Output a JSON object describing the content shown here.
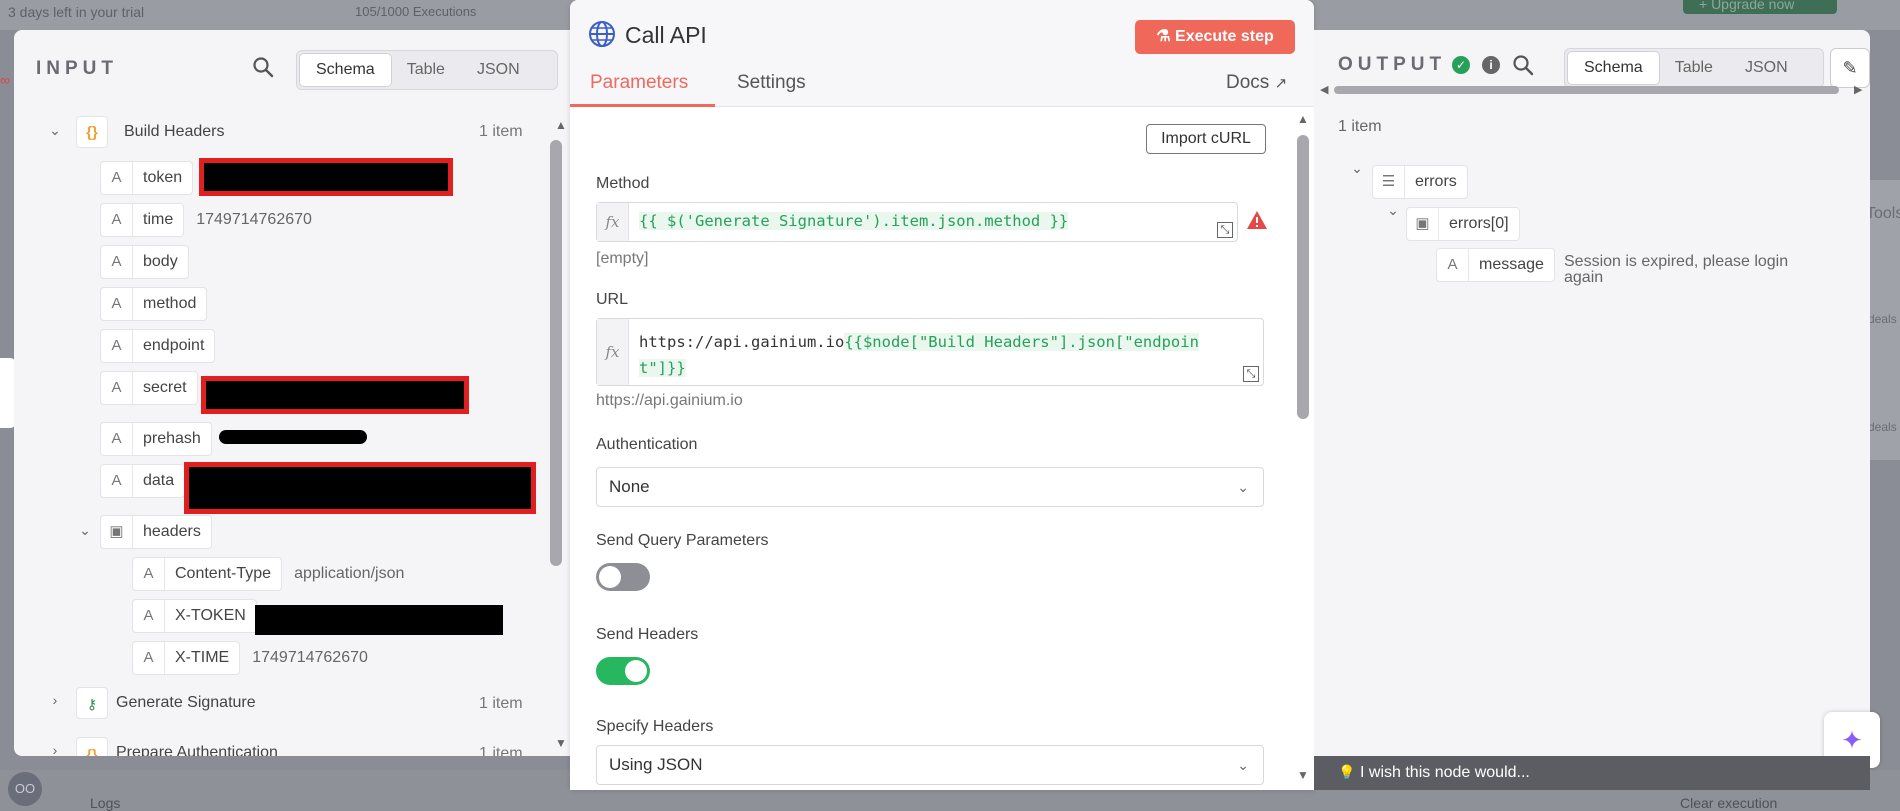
{
  "background": {
    "trial_text": "3 days left in your trial",
    "executions": "105/1000 Executions",
    "upgrade": "+ Upgrade now",
    "logs": "Logs",
    "clear_execution": "Clear execution",
    "avatar": "OO",
    "right_text_1": "Tools",
    "right_text_2": "deals",
    "right_text_3": "deals"
  },
  "input": {
    "title": "INPUT",
    "views": [
      "Schema",
      "Table",
      "JSON"
    ],
    "active_view": "Schema",
    "nodes": [
      {
        "name": "Build Headers",
        "count": "1 item",
        "fields": [
          {
            "key": "token",
            "value": ""
          },
          {
            "key": "time",
            "value": "1749714762670"
          },
          {
            "key": "body",
            "value": ""
          },
          {
            "key": "method",
            "value": ""
          },
          {
            "key": "endpoint",
            "value": ""
          },
          {
            "key": "secret",
            "value": ""
          },
          {
            "key": "prehash",
            "value": ""
          },
          {
            "key": "data",
            "value": ""
          }
        ],
        "headers": {
          "label": "headers",
          "fields": [
            {
              "key": "Content-Type",
              "value": "application/json"
            },
            {
              "key": "X-TOKEN",
              "value": ""
            },
            {
              "key": "X-TIME",
              "value": "1749714762670"
            }
          ]
        }
      },
      {
        "name": "Generate Signature",
        "count": "1 item"
      },
      {
        "name": "Prepare Authentication",
        "count": "1 item"
      }
    ]
  },
  "center": {
    "title": "Call API",
    "execute_label": "Execute step",
    "tabs": [
      "Parameters",
      "Settings"
    ],
    "active_tab": "Parameters",
    "docs_label": "Docs",
    "import_curl": "Import cURL",
    "method": {
      "label": "Method",
      "expression": "{{ $('Generate Signature').item.json.method }}",
      "result": "[empty]"
    },
    "url": {
      "label": "URL",
      "prefix": "https://api.gainium.io",
      "expression_line1": "{{$node[\"Build Headers\"].json[\"endpoin",
      "expression_line2": "t\"]}}",
      "result": "https://api.gainium.io"
    },
    "authentication": {
      "label": "Authentication",
      "value": "None"
    },
    "send_query": {
      "label": "Send Query Parameters",
      "enabled": false
    },
    "send_headers": {
      "label": "Send Headers",
      "enabled": true
    },
    "specify_headers": {
      "label": "Specify Headers",
      "value": "Using JSON"
    }
  },
  "output": {
    "title": "OUTPUT",
    "views": [
      "Schema",
      "Table",
      "JSON"
    ],
    "active_view": "Schema",
    "count": "1 item",
    "tree": {
      "root": "errors",
      "child": "errors[0]",
      "field_key": "message",
      "field_value_line1": "Session is expired, please login",
      "field_value_line2": "again"
    },
    "wish": "I wish this node would..."
  },
  "colors": {
    "accent": "#ee6a5c",
    "success": "#27a15a",
    "redaction": "#e02020"
  }
}
